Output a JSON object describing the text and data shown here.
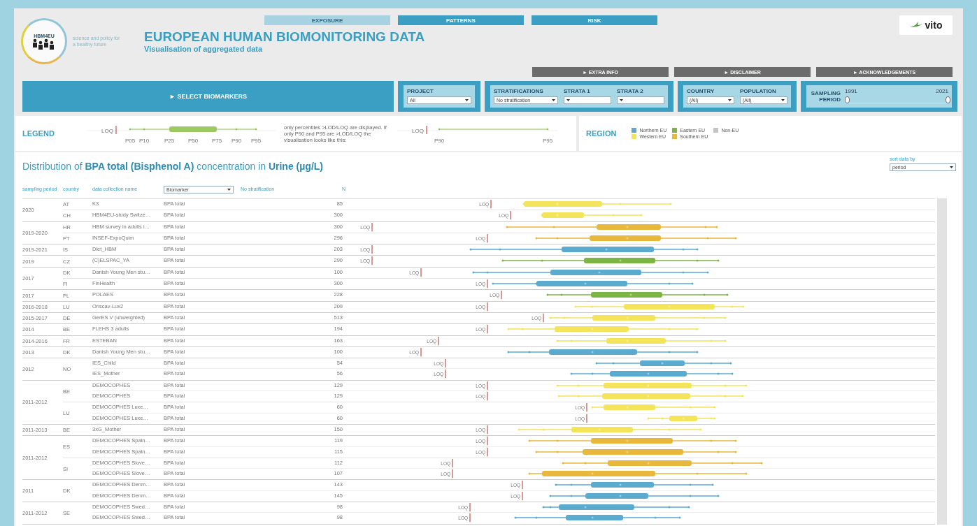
{
  "header": {
    "logo_text": "HBM4EU",
    "tagline": "science and policy for a healthy future",
    "title": "EUROPEAN HUMAN BIOMONITORING DATA",
    "subtitle": "Visualisation of aggregated data",
    "partner_logo": "vito"
  },
  "nav_tabs": [
    {
      "label": "EXPOSURE",
      "selected": true
    },
    {
      "label": "PATTERNS",
      "selected": false
    },
    {
      "label": "RISK",
      "selected": false
    }
  ],
  "info_buttons": [
    "► EXTRA INFO",
    "► DISCLAIMER",
    "► ACKNOWLEDGEMENTS"
  ],
  "filters": {
    "select_biomarkers": "► SELECT BIOMARKERS",
    "groups": [
      {
        "fields": [
          {
            "label": "PROJECT",
            "value": "All"
          }
        ]
      },
      {
        "fields": [
          {
            "label": "STRATIFICATIONS",
            "value": "No stratification"
          },
          {
            "label": "STRATA 1"
          },
          {
            "label": "STRATA 2"
          }
        ]
      },
      {
        "fields": [
          {
            "label": "COUNTRY",
            "value": "(All)"
          },
          {
            "label": "POPULATION",
            "value": "(All)"
          }
        ]
      }
    ],
    "sampling_period": {
      "label": "SAMPLING PERIOD",
      "ticks": [
        "1991",
        "2021"
      ],
      "handles": [
        {
          "level": 0
        },
        {
          "level": 1
        }
      ]
    }
  },
  "legend": {
    "title": "LEGEND",
    "example_full": {
      "loq": "LOQ",
      "labels": [
        "P05",
        "P10",
        "P25",
        "P50",
        "P75",
        "P90",
        "P95"
      ]
    },
    "note": "only percentiles >LOD/LOQ are displayed. If only P90 and P95 are >LOD/LOQ the visualisation looks like this:",
    "example_partial": {
      "loq": "LOQ",
      "labels": [
        "P90",
        "P95"
      ]
    },
    "region_title": "REGION",
    "regions": [
      {
        "name": "Northern EU",
        "color": "#5aabcf"
      },
      {
        "name": "Eastern EU",
        "color": "#7db544"
      },
      {
        "name": "Non-EU",
        "color": "#c4c4c4"
      },
      {
        "name": "Western EU",
        "color": "#f3e45a"
      },
      {
        "name": "Southern EU",
        "color": "#e8b83c"
      }
    ]
  },
  "distribution": {
    "title": "Distribution of **BPA total (Bisphenol A)** concentration in **Urine** **(µg/L)**",
    "sort": {
      "label": "sort data by",
      "value": "period"
    },
    "columns": {
      "period": "sampling period",
      "country": "country",
      "name": "data collection name",
      "biomarker": "Biomarker",
      "stratification": "No stratification",
      "n": "N"
    },
    "periods": [
      {
        "period": "2020",
        "countries": [
          {
            "country": "AT",
            "rows": [
              {
                "name": "K3",
                "biomarker": "BPA total",
                "n": "85",
                "color": "#f3e45a",
                "loq": "LOQ"
              }
            ]
          },
          {
            "country": "CH",
            "rows": [
              {
                "name": "HBM4EU-study Switze…",
                "biomarker": "BPA total",
                "n": "300",
                "color": "#f3e45a",
                "loq": "LOQ"
              }
            ]
          }
        ]
      },
      {
        "period": "2019-2020",
        "countries": [
          {
            "country": "HR",
            "rows": [
              {
                "name": "HBM survey in adults i…",
                "biomarker": "BPA total",
                "n": "300",
                "color": "#e8b83c",
                "loq": "LOQ"
              }
            ]
          },
          {
            "country": "PT",
            "rows": [
              {
                "name": "INSEF-ExpoQuim",
                "biomarker": "BPA total",
                "n": "296",
                "color": "#e8b83c",
                "loq": "LOQ"
              }
            ]
          }
        ]
      },
      {
        "period": "2019-2021",
        "countries": [
          {
            "country": "IS",
            "rows": [
              {
                "name": "Diet_HBM",
                "biomarker": "BPA total",
                "n": "203",
                "color": "#5aabcf",
                "loq": "LOQ"
              }
            ]
          }
        ]
      },
      {
        "period": "2019",
        "countries": [
          {
            "country": "CZ",
            "rows": [
              {
                "name": "(C)ELSPAC_YA",
                "biomarker": "BPA total",
                "n": "290",
                "color": "#7db544",
                "loq": "LOQ"
              }
            ]
          }
        ]
      },
      {
        "period": "2017",
        "countries": [
          {
            "country": "DK",
            "rows": [
              {
                "name": "Danish Young Men stu…",
                "biomarker": "BPA total",
                "n": "100",
                "color": "#5aabcf",
                "loq": "LOQ"
              }
            ]
          },
          {
            "country": "FI",
            "rows": [
              {
                "name": "FinHealth",
                "biomarker": "BPA total",
                "n": "300",
                "color": "#5aabcf",
                "loq": "LOQ"
              }
            ]
          }
        ]
      },
      {
        "period": "2017",
        "countries": [
          {
            "country": "PL",
            "rows": [
              {
                "name": "POLAES",
                "biomarker": "BPA total",
                "n": "228",
                "color": "#7db544",
                "loq": "LOQ"
              }
            ]
          }
        ]
      },
      {
        "period": "2016-2018",
        "countries": [
          {
            "country": "LU",
            "rows": [
              {
                "name": "Oriscav-Lux2",
                "biomarker": "BPA total",
                "n": "209",
                "color": "#f3e45a",
                "loq": "LOQ"
              }
            ]
          }
        ]
      },
      {
        "period": "2015-2017",
        "countries": [
          {
            "country": "DE",
            "rows": [
              {
                "name": "GerES V (unweighted)",
                "biomarker": "BPA total",
                "n": "513",
                "color": "#f3e45a",
                "loq": "LOQ"
              }
            ]
          }
        ]
      },
      {
        "period": "2014",
        "countries": [
          {
            "country": "BE",
            "rows": [
              {
                "name": "FLEHS 3 adults",
                "biomarker": "BPA total",
                "n": "194",
                "color": "#f3e45a",
                "loq": "LOQ"
              }
            ]
          }
        ]
      },
      {
        "period": "2014-2016",
        "countries": [
          {
            "country": "FR",
            "rows": [
              {
                "name": "ESTEBAN",
                "biomarker": "BPA total",
                "n": "163",
                "color": "#f3e45a",
                "loq": "LOQ"
              }
            ]
          }
        ]
      },
      {
        "period": "2013",
        "countries": [
          {
            "country": "DK",
            "rows": [
              {
                "name": "Danish Young Men stu…",
                "biomarker": "BPA total",
                "n": "100",
                "color": "#5aabcf",
                "loq": "LOQ"
              }
            ]
          }
        ]
      },
      {
        "period": "2012",
        "countries": [
          {
            "country": "NO",
            "rows": [
              {
                "name": "IES_Child",
                "biomarker": "BPA total",
                "n": "54",
                "color": "#5aabcf",
                "loq": "LOQ"
              },
              {
                "name": "IES_Mother",
                "biomarker": "BPA total",
                "n": "56",
                "color": "#5aabcf",
                "loq": "LOQ"
              }
            ]
          }
        ]
      },
      {
        "period": "2011-2012",
        "countries": [
          {
            "country": "BE",
            "rows": [
              {
                "name": "DEMOCOPHES",
                "biomarker": "BPA total",
                "n": "129",
                "color": "#f3e45a",
                "loq": "LOQ"
              },
              {
                "name": "DEMOCOPHES",
                "biomarker": "BPA total",
                "n": "129",
                "color": "#f3e45a",
                "loq": "LOQ"
              }
            ]
          },
          {
            "country": "LU",
            "rows": [
              {
                "name": "DEMOCOPHES Luxe…",
                "biomarker": "BPA total",
                "n": "60",
                "color": "#f3e45a",
                "loq": "LOQ"
              },
              {
                "name": "DEMOCOPHES Luxe…",
                "biomarker": "BPA total",
                "n": "60",
                "color": "#f3e45a",
                "loq": "LOQ"
              }
            ]
          }
        ]
      },
      {
        "period": "2011-2013",
        "countries": [
          {
            "country": "BE",
            "rows": [
              {
                "name": "3xG_Mother",
                "biomarker": "BPA total",
                "n": "150",
                "color": "#f3e45a",
                "loq": "LOQ"
              }
            ]
          }
        ]
      },
      {
        "period": "2011-2012",
        "countries": [
          {
            "country": "ES",
            "rows": [
              {
                "name": "DEMOCOPHES Spain…",
                "biomarker": "BPA total",
                "n": "119",
                "color": "#e8b83c",
                "loq": "LOQ"
              },
              {
                "name": "DEMOCOPHES Spain…",
                "biomarker": "BPA total",
                "n": "115",
                "color": "#e8b83c",
                "loq": "LOQ"
              }
            ]
          },
          {
            "country": "SI",
            "rows": [
              {
                "name": "DEMOCOPHES Slove…",
                "biomarker": "BPA total",
                "n": "112",
                "color": "#e8b83c",
                "loq": "LOQ"
              },
              {
                "name": "DEMOCOPHES Slove…",
                "biomarker": "BPA total",
                "n": "107",
                "color": "#e8b83c",
                "loq": "LOQ"
              }
            ]
          }
        ]
      },
      {
        "period": "2011",
        "countries": [
          {
            "country": "DK",
            "rows": [
              {
                "name": "DEMOCOPHES Denm…",
                "biomarker": "BPA total",
                "n": "143",
                "color": "#5aabcf",
                "loq": "LOQ"
              },
              {
                "name": "DEMOCOPHES Denm…",
                "biomarker": "BPA total",
                "n": "145",
                "color": "#5aabcf",
                "loq": "LOQ"
              }
            ]
          }
        ]
      },
      {
        "period": "2011-2012",
        "countries": [
          {
            "country": "SE",
            "rows": [
              {
                "name": "DEMOCOPHES Swed…",
                "biomarker": "BPA total",
                "n": "98",
                "color": "#5aabcf",
                "loq": "LOQ"
              },
              {
                "name": "DEMOCOPHES Swed…",
                "biomarker": "BPA total",
                "n": "98",
                "color": "#5aabcf",
                "loq": "LOQ"
              }
            ]
          }
        ]
      }
    ]
  }
}
